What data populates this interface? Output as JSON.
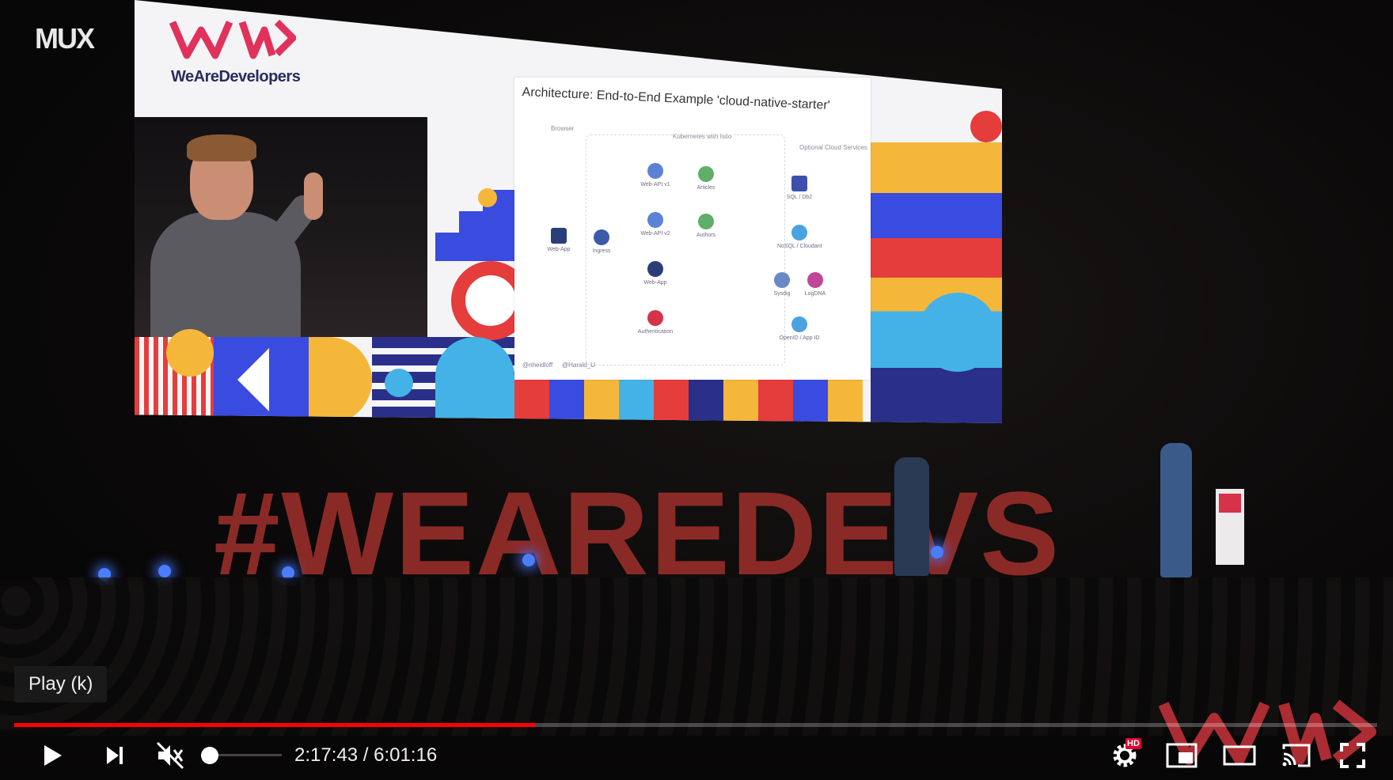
{
  "player": {
    "tooltip": "Play (k)",
    "current_time": "2:17:43",
    "duration": "6:01:16",
    "time_separator": " / ",
    "progress": 0.382,
    "volume": 0.0,
    "muted": true,
    "hd_badge": "HD",
    "accent_color": "#ff0000"
  },
  "video": {
    "mux_logo": "MUX",
    "brand_name": "WeAreDevelopers",
    "stage_hashtag": "#WEAREDEVS",
    "slide": {
      "title": "Architecture: End-to-End Example 'cloud-native-starter'",
      "columns": [
        "Browser",
        "Kubernetes with Istio",
        "Optional Cloud Services"
      ],
      "nodes": [
        "Web-App",
        "Ingress",
        "Web-API v1",
        "Web-API v2",
        "Articles",
        "Authors",
        "Web-App",
        "Authentication",
        "SQL / Db2",
        "NoSQL / Cloudant",
        "Sysdig",
        "LogDNA",
        "OpenID / App ID"
      ],
      "handles": [
        "@nheidloff",
        "@Harald_U"
      ]
    }
  },
  "icons": [
    "play-icon",
    "next-icon",
    "volume-muted-icon",
    "settings-icon",
    "miniplayer-icon",
    "theater-mode-icon",
    "cast-icon",
    "fullscreen-icon"
  ]
}
